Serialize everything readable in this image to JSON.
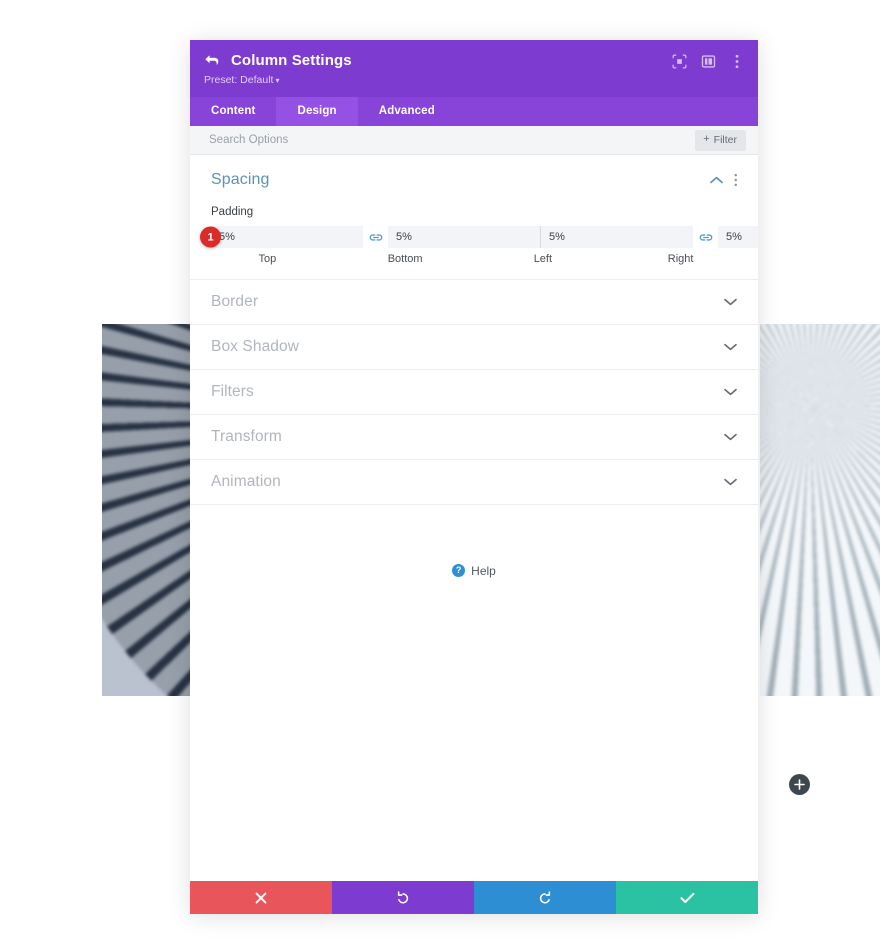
{
  "modal": {
    "header": {
      "title": "Column Settings",
      "preset_label": "Preset: Default",
      "preset_caret": "▾",
      "back_icon": "back-arrow-icon",
      "actions": [
        {
          "name": "focus-target-icon",
          "label": ""
        },
        {
          "name": "layout-columns-icon",
          "label": ""
        },
        {
          "name": "more-options-icon",
          "label": ""
        }
      ]
    },
    "tabs": [
      {
        "label": "Content",
        "active": false
      },
      {
        "label": "Design",
        "active": true
      },
      {
        "label": "Advanced",
        "active": false
      }
    ],
    "search": {
      "placeholder": "Search Options",
      "value": "",
      "filter_label": "Filter",
      "filter_plus": "+"
    },
    "spacing_section": {
      "title": "Spacing",
      "collapse_icon": "chevron-up-icon",
      "options_icon": "kebab-menu-icon",
      "padding_label": "Padding",
      "marker_number": "1",
      "fields": [
        {
          "caption": "Top",
          "value": "5%"
        },
        {
          "caption": "Bottom",
          "value": "5%"
        },
        {
          "caption": "Left",
          "value": "5%"
        },
        {
          "caption": "Right",
          "value": "5%"
        }
      ],
      "link_icon": "link-chain-icon"
    },
    "collapsed_sections": [
      {
        "title": "Border"
      },
      {
        "title": "Box Shadow"
      },
      {
        "title": "Filters"
      },
      {
        "title": "Transform"
      },
      {
        "title": "Animation"
      }
    ],
    "help": {
      "badge": "?",
      "label": "Help"
    },
    "footer_buttons": [
      {
        "name": "cancel-button",
        "icon": "close-x-icon",
        "color": "#e8565b"
      },
      {
        "name": "undo-button",
        "icon": "undo-arrow-icon",
        "color": "#7e3bd0"
      },
      {
        "name": "redo-button",
        "icon": "redo-arrow-icon",
        "color": "#2e8ed4"
      },
      {
        "name": "save-button",
        "icon": "checkmark-icon",
        "color": "#2bc2a4"
      }
    ]
  },
  "canvas": {
    "add_module_label": "+"
  },
  "colors": {
    "header_purple": "#7e3bd0",
    "tabs_purple": "#8843d8",
    "tab_active_purple": "#9451e3",
    "section_title_blue": "#5b93b8",
    "marker_red": "#da2b2b",
    "help_blue": "#2d8fd5",
    "link_blue": "#4b9fd5"
  }
}
